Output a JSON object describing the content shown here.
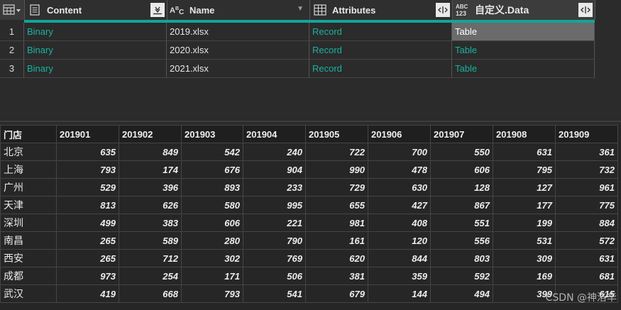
{
  "query_table": {
    "columns": [
      {
        "name": "Content",
        "type_icon": "binary-column-icon",
        "action_icon": "expand-binary-icon"
      },
      {
        "name": "Name",
        "type_icon": "text-type-icon",
        "type_label": "ABC",
        "action_icon": "chevron-down-icon"
      },
      {
        "name": "Attributes",
        "type_icon": "table-column-icon",
        "action_icon": "expand-columns-icon"
      },
      {
        "name": "自定义.Data",
        "type_icon": "any-type-icon",
        "type_label_top": "ABC",
        "type_label_bottom": "123",
        "action_icon": "expand-columns-icon"
      }
    ],
    "rows": [
      {
        "num": "1",
        "content": "Binary",
        "name": "2019.xlsx",
        "attributes": "Record",
        "data": "Table"
      },
      {
        "num": "2",
        "content": "Binary",
        "name": "2020.xlsx",
        "attributes": "Record",
        "data": "Table"
      },
      {
        "num": "3",
        "content": "Binary",
        "name": "2021.xlsx",
        "attributes": "Record",
        "data": "Table"
      }
    ],
    "accent_color": "#11a69a",
    "link_color": "#19b39f"
  },
  "preview": {
    "headers": [
      "门店",
      "201901",
      "201902",
      "201903",
      "201904",
      "201905",
      "201906",
      "201907",
      "201908",
      "201909"
    ],
    "rows": [
      {
        "store": "北京",
        "values": [
          "635",
          "849",
          "542",
          "240",
          "722",
          "700",
          "550",
          "631",
          "361"
        ]
      },
      {
        "store": "上海",
        "values": [
          "793",
          "174",
          "676",
          "904",
          "990",
          "478",
          "606",
          "795",
          "732"
        ]
      },
      {
        "store": "广州",
        "values": [
          "529",
          "396",
          "893",
          "233",
          "729",
          "630",
          "128",
          "127",
          "961"
        ]
      },
      {
        "store": "天津",
        "values": [
          "813",
          "626",
          "580",
          "995",
          "655",
          "427",
          "867",
          "177",
          "775"
        ]
      },
      {
        "store": "深圳",
        "values": [
          "499",
          "383",
          "606",
          "221",
          "981",
          "408",
          "551",
          "199",
          "884"
        ]
      },
      {
        "store": "南昌",
        "values": [
          "265",
          "589",
          "280",
          "790",
          "161",
          "120",
          "556",
          "531",
          "572"
        ]
      },
      {
        "store": "西安",
        "values": [
          "265",
          "712",
          "302",
          "769",
          "620",
          "844",
          "803",
          "309",
          "631"
        ]
      },
      {
        "store": "成都",
        "values": [
          "973",
          "254",
          "171",
          "506",
          "381",
          "359",
          "592",
          "169",
          "681"
        ]
      },
      {
        "store": "武汉",
        "values": [
          "419",
          "668",
          "793",
          "541",
          "679",
          "144",
          "494",
          "399",
          "615"
        ]
      }
    ]
  },
  "watermark": "CSDN @神洛华"
}
